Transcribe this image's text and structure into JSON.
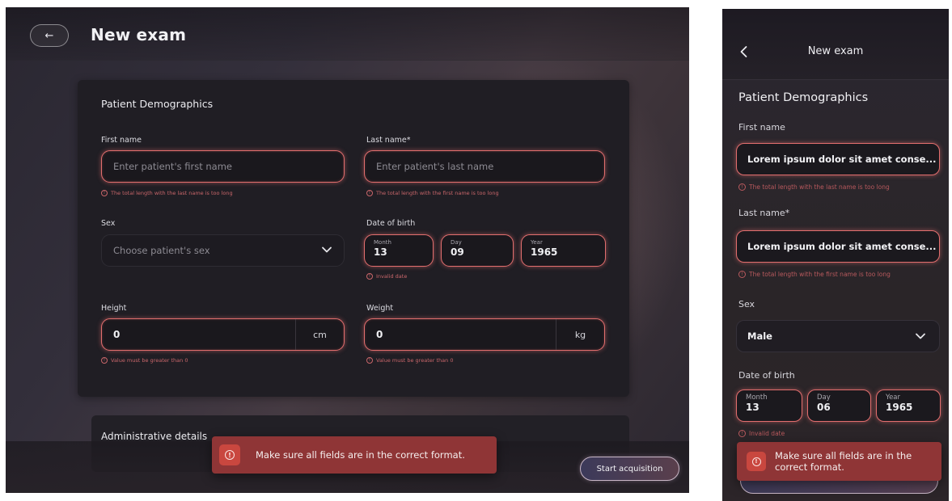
{
  "desktop": {
    "header": {
      "title": "New exam",
      "back_icon": "arrow-left-icon"
    },
    "demographics": {
      "title": "Patient Demographics",
      "first_name": {
        "label": "First name",
        "placeholder": "Enter patient's first name",
        "error": "The total length with the last name is too long"
      },
      "last_name": {
        "label": "Last name*",
        "placeholder": "Enter patient's last name",
        "error": "The total length with the first name is too long"
      },
      "sex": {
        "label": "Sex",
        "placeholder": "Choose patient's sex"
      },
      "dob": {
        "label": "Date of birth",
        "month_label": "Month",
        "month": "13",
        "day_label": "Day",
        "day": "09",
        "year_label": "Year",
        "year": "1965",
        "error": "Invalid date"
      },
      "height": {
        "label": "Height",
        "value": "0",
        "unit": "cm",
        "error": "Value must be greater than 0"
      },
      "weight": {
        "label": "Weight",
        "value": "0",
        "unit": "kg",
        "error": "Value must be greater than 0"
      }
    },
    "administrative": {
      "title": "Administrative details"
    },
    "toast": {
      "message": "Make sure all fields are in the correct format."
    },
    "start_button": "Start acquisition"
  },
  "mobile": {
    "header": {
      "title": "New exam"
    },
    "section_title": "Patient Demographics",
    "first_name": {
      "label": "First name",
      "value": "Lorem ipsum dolor sit amet conse...",
      "error": "The total length with the last name is too long"
    },
    "last_name": {
      "label": "Last name*",
      "value": "Lorem ipsum dolor sit amet conse...",
      "error": "The total length with the first name is too long"
    },
    "sex": {
      "label": "Sex",
      "value": "Male"
    },
    "dob": {
      "label": "Date of birth",
      "month_label": "Month",
      "month": "13",
      "day_label": "Day",
      "day": "06",
      "year_label": "Year",
      "year": "1965",
      "error": "Invalid date"
    },
    "toast": {
      "message": "Make sure all fields are in the correct format."
    }
  },
  "colors": {
    "error": "#e26e6e",
    "toast": "#8f3536",
    "toast_icon": "#c9473f",
    "card": "#201e24"
  }
}
